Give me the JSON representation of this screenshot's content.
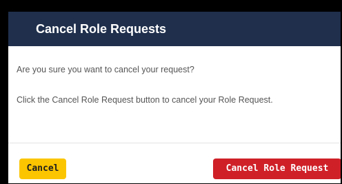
{
  "dialog": {
    "title": "Cancel Role Requests",
    "message": "Are you sure you want to cancel your request?",
    "instruction": "Click the Cancel Role Request button to cancel your Role Request.",
    "cancel_label": "Cancel",
    "confirm_label": "Cancel Role Request"
  },
  "colors": {
    "header_bg": "#1f2f4c",
    "cancel_button": "#fbc500",
    "confirm_button": "#cf2028",
    "body_text": "#555555"
  }
}
